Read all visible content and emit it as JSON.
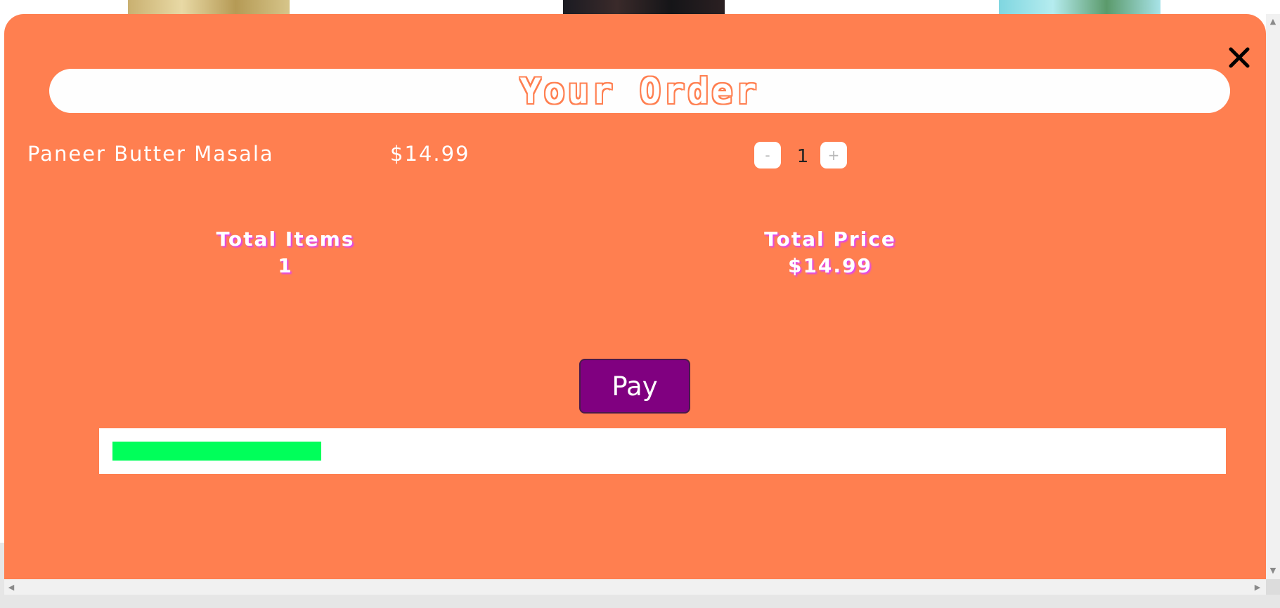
{
  "order_modal": {
    "title": "Your Order",
    "close_glyph": "✕",
    "items": [
      {
        "name": "Paneer Butter Masala",
        "price": "$14.99",
        "quantity": "1"
      }
    ],
    "decrement_label": "-",
    "increment_label": "+",
    "totals": {
      "items_label": "Total Items",
      "items_value": "1",
      "price_label": "Total Price",
      "price_value": "$14.99"
    },
    "pay_label": "Pay",
    "progress_fraction": 0.19
  },
  "colors": {
    "modal_background": "#ff7f50",
    "pay_button": "#800080",
    "progress_fill": "#00ff5a",
    "totals_shadow": "#e040fb"
  },
  "icons": {
    "close": "close-icon",
    "scroll_up": "scroll-up-arrow-icon",
    "scroll_down": "scroll-down-arrow-icon",
    "scroll_left": "scroll-left-arrow-icon",
    "scroll_right": "scroll-right-arrow-icon"
  }
}
